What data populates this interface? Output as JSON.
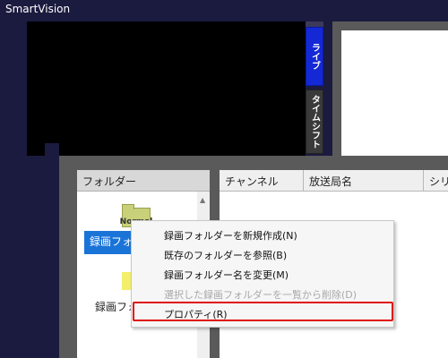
{
  "app": {
    "title": "SmartVision"
  },
  "tabs": {
    "live": "ライブ",
    "timeshift": "タイムシフト"
  },
  "folder_panel": {
    "header": "フォルダー",
    "normal_icon_label": "Normal",
    "items": [
      {
        "label": "録画フォルダー",
        "selected": true
      },
      {
        "label": "録画フォルダー",
        "selected": false
      }
    ]
  },
  "channel_table": {
    "columns": [
      "チャンネル",
      "放送局名",
      "シリーズ"
    ]
  },
  "context_menu": {
    "items": [
      {
        "label": "録画フォルダーを新規作成(N)",
        "enabled": true
      },
      {
        "label": "既存のフォルダーを参照(B)",
        "enabled": true
      },
      {
        "label": "録画フォルダー名を変更(M)",
        "enabled": true
      },
      {
        "label": "選択した録画フォルダーを一覧から削除(D)",
        "enabled": false
      },
      {
        "label": "プロパティ(R)",
        "enabled": true,
        "highlighted": true
      }
    ]
  },
  "colors": {
    "background": "#1b1a3f",
    "live_tab": "#1428d6",
    "selection": "#1a74d8",
    "highlight": "#e01010"
  }
}
